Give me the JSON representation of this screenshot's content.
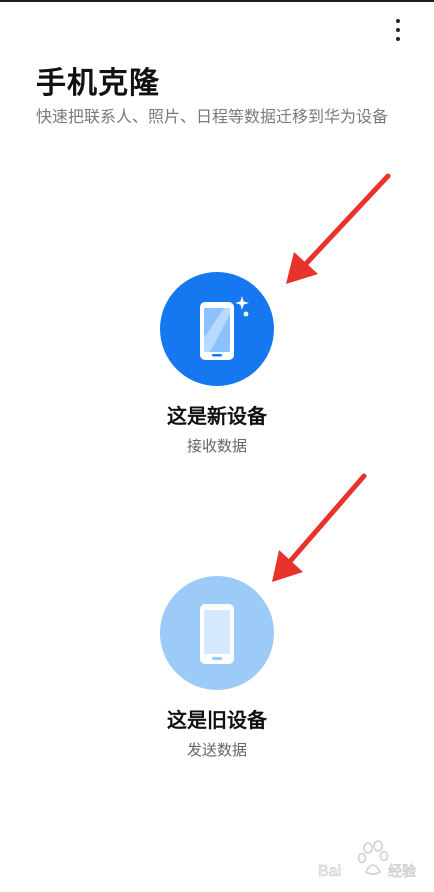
{
  "header": {
    "menu_icon": "more-vertical-icon"
  },
  "page": {
    "title": "手机克隆",
    "subtitle": "快速把联系人、照片、日程等数据迁移到华为设备"
  },
  "options": [
    {
      "label": "这是新设备",
      "sub": "接收数据",
      "icon": "phone-sparkle-icon",
      "color": "#1578f0"
    },
    {
      "label": "这是旧设备",
      "sub": "发送数据",
      "icon": "phone-icon",
      "color": "#9ccbf8"
    }
  ],
  "annotations": {
    "arrow_color": "#e8332c"
  },
  "watermark": {
    "text": "Baidu经验"
  }
}
